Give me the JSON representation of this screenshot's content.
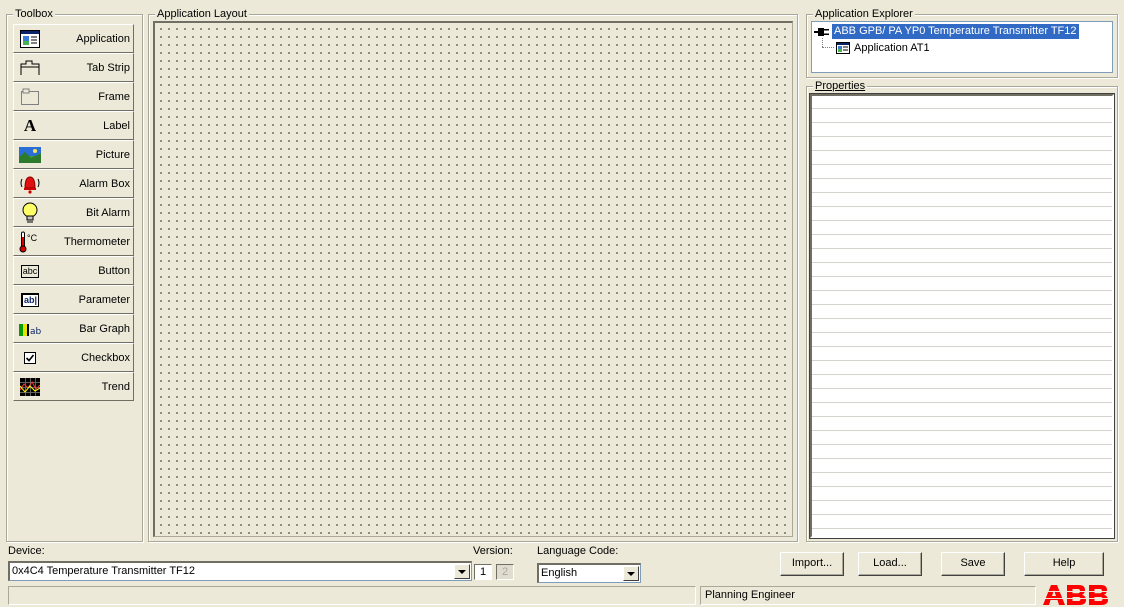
{
  "toolbox": {
    "title": "Toolbox",
    "items": [
      {
        "label": "Application",
        "icon": "application-icon"
      },
      {
        "label": "Tab Strip",
        "icon": "tab-strip-icon"
      },
      {
        "label": "Frame",
        "icon": "frame-icon"
      },
      {
        "label": "Label",
        "icon": "label-icon",
        "glyph": "A"
      },
      {
        "label": "Picture",
        "icon": "picture-icon"
      },
      {
        "label": "Alarm Box",
        "icon": "alarm-bell-icon"
      },
      {
        "label": "Bit Alarm",
        "icon": "lightbulb-icon"
      },
      {
        "label": "Thermometer",
        "icon": "thermometer-icon",
        "glyph": "°C"
      },
      {
        "label": "Button",
        "icon": "button-icon",
        "glyph": "abc"
      },
      {
        "label": "Parameter",
        "icon": "parameter-icon",
        "glyph": "ab|"
      },
      {
        "label": "Bar Graph",
        "icon": "bar-graph-icon",
        "glyph": "ab"
      },
      {
        "label": "Checkbox",
        "icon": "checkbox-icon",
        "glyph": "☑"
      },
      {
        "label": "Trend",
        "icon": "trend-icon"
      }
    ]
  },
  "layout": {
    "title": "Application Layout"
  },
  "explorer": {
    "title": "Application Explorer",
    "root": "ABB GPB/ PA YP0 Temperature Transmitter TF12",
    "child": "Application AT1"
  },
  "properties": {
    "title": "Properties"
  },
  "device": {
    "label": "Device:",
    "value": "0x4C4 Temperature Transmitter TF12"
  },
  "version": {
    "label": "Version:",
    "v1": "1",
    "v2": "2"
  },
  "language": {
    "label": "Language Code:",
    "value": "English"
  },
  "buttons": {
    "import": "Import...",
    "load": "Load...",
    "save": "Save",
    "help": "Help"
  },
  "status": {
    "role": "Planning Engineer"
  },
  "logo": {
    "text": "ABB",
    "color": "#ff0000"
  },
  "colors": {
    "selection": "#316ac5",
    "background": "#ece9d8"
  }
}
